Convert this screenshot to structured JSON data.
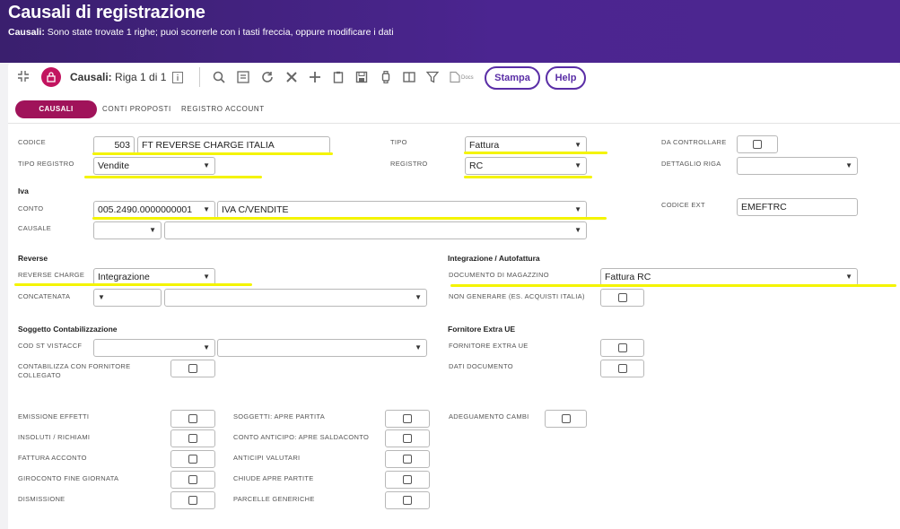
{
  "header": {
    "title": "Causali di registrazione",
    "sub_bold": "Causali:",
    "sub_text": "Sono state trovate 1 righe; puoi scorrerle con i tasti freccia, oppure modificare i dati"
  },
  "toolbar": {
    "crumb_bold": "Causali:",
    "crumb_text": "Riga 1 di 1",
    "docs_label": "Docs",
    "stampa_label": "Stampa",
    "help_label": "Help"
  },
  "tabs": {
    "active": "CAUSALI",
    "items": [
      "CONTI PROPOSTI",
      "REGISTRO ACCOUNT"
    ]
  },
  "form": {
    "codice_label": "CODICE",
    "codice_value": "503",
    "codice_desc": "FT REVERSE CHARGE ITALIA",
    "tipo_registro_label": "TIPO REGISTRO",
    "tipo_registro_value": "Vendite",
    "tipo_label": "TIPO",
    "tipo_value": "Fattura",
    "registro_label": "REGISTRO",
    "registro_value": "RC",
    "da_controllare_label": "DA CONTROLLARE",
    "dettaglio_riga_label": "DETTAGLIO RIGA",
    "dettaglio_riga_value": "",
    "iva_section": "Iva",
    "conto_label": "CONTO",
    "conto_value": "005.2490.0000000001",
    "conto_desc": "IVA C/VENDITE",
    "codice_ext_label": "CODICE EXT",
    "codice_ext_value": "EMEFTRC",
    "causale_label": "CAUSALE",
    "causale_value": "",
    "causale_desc": "",
    "reverse_section": "Reverse",
    "reverse_charge_label": "REVERSE CHARGE",
    "reverse_charge_value": "Integrazione",
    "concatenata_label": "CONCATENATA",
    "concatenata_value": "",
    "concatenata_desc": "",
    "integr_section": "Integrazione / Autofattura",
    "doc_magazzino_label": "DOCUMENTO DI MAGAZZINO",
    "doc_magazzino_value": "Fattura RC",
    "non_generare_label": "NON GENERARE (ES. ACQUISTI ITALIA)",
    "soggetto_section": "Soggetto Contabilizzazione",
    "cod_st_label": "COD ST VISTACCF",
    "cod_st_value": "",
    "cod_st_desc": "",
    "contabilizza_label_1": "CONTABILIZZA CON FORNITORE",
    "contabilizza_label_2": "COLLEGATO",
    "fornitore_section": "Fornitore Extra UE",
    "fornitore_extra_label": "FORNITORE EXTRA UE",
    "dati_documento_label": "DATI DOCUMENTO",
    "col1": [
      "EMISSIONE EFFETTI",
      "INSOLUTI / RICHIAMI",
      "FATTURA ACCONTO",
      "GIROCONTO FINE GIORNATA",
      "DISMISSIONE"
    ],
    "col2": [
      "SOGGETTI: APRE PARTITA",
      "CONTO ANTICIPO: APRE SALDACONTO",
      "ANTICIPI VALUTARI",
      "CHIUDE APRE PARTITE",
      "PARCELLE GENERICHE"
    ],
    "adeguamento_label": "ADEGUAMENTO CAMBI"
  },
  "colors": {
    "header": "#4b2590",
    "accent": "#a0135a",
    "button": "#5a2ea6",
    "highlight": "#f4f400"
  }
}
